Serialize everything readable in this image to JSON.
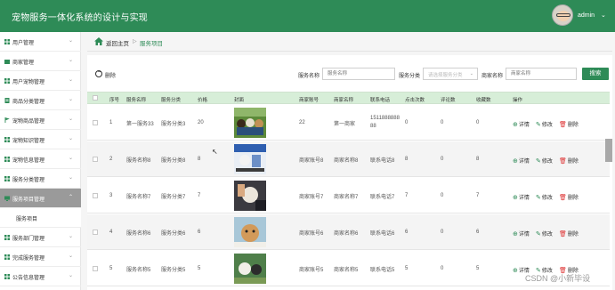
{
  "app": {
    "title": "宠物服务一体化系统的设计与实现",
    "user": "admin",
    "colors": {
      "header": "#2e8b57",
      "table_header": "#d7eed8",
      "accent": "#2e8b57",
      "delete": "#dd3333"
    }
  },
  "sidebar": {
    "items": [
      {
        "label": "用户管理",
        "icon": "grid-icon"
      },
      {
        "label": "商家管理",
        "icon": "folder-icon"
      },
      {
        "label": "用户宠物管理",
        "icon": "grid-icon"
      },
      {
        "label": "商品分类管理",
        "icon": "doc-icon"
      },
      {
        "label": "宠物商品管理",
        "icon": "flag-icon"
      },
      {
        "label": "宠物知识管理",
        "icon": "grid-icon"
      },
      {
        "label": "宠物信息管理",
        "icon": "grid-icon"
      },
      {
        "label": "服务分类管理",
        "icon": "grid-icon"
      },
      {
        "label": "服务项目管理",
        "icon": "monitor-icon",
        "active": true
      },
      {
        "label": "服务项目",
        "sub": true
      },
      {
        "label": "服务部门管理",
        "icon": "grid-icon"
      },
      {
        "label": "完成服务管理",
        "icon": "grid-icon"
      },
      {
        "label": "公告信息管理",
        "icon": "grid-icon"
      }
    ]
  },
  "breadcrumb": {
    "home": "返回主页",
    "separator": "▷",
    "current": "服务项目"
  },
  "toolbar": {
    "delete_label": "删除",
    "search_label": "搜索"
  },
  "filters": {
    "name": {
      "label": "服务名称",
      "placeholder": "服务名称"
    },
    "category": {
      "label": "服务分类",
      "placeholder": "请选择服务分类"
    },
    "merchant": {
      "label": "商家名称",
      "placeholder": "商家名称"
    }
  },
  "table": {
    "headers": [
      "序号",
      "服务名称",
      "服务分类",
      "价格",
      "封面",
      "商家账号",
      "商家名称",
      "联系电话",
      "点击次数",
      "评论数",
      "收藏数",
      "操作"
    ],
    "actions": {
      "detail": "详情",
      "edit": "修改",
      "delete": "删除"
    },
    "rows": [
      {
        "no": "1",
        "name": "第一服务33",
        "category": "服务分类3",
        "price": "20",
        "cover": "dogs-group-photo",
        "account": "22",
        "merchant": "第一商家",
        "phone": "151188888888",
        "clicks": "0",
        "comments": "0",
        "favorites": "0"
      },
      {
        "no": "2",
        "name": "服务名称8",
        "category": "服务分类8",
        "price": "8",
        "cover": "pet-grooming-photo",
        "account": "商家账号8",
        "merchant": "商家名称8",
        "phone": "联系电话8",
        "clicks": "8",
        "comments": "0",
        "favorites": "8"
      },
      {
        "no": "3",
        "name": "服务名称7",
        "category": "服务分类7",
        "price": "7",
        "cover": "dog-bath-photo",
        "account": "商家账号7",
        "merchant": "商家名称7",
        "phone": "联系电话7",
        "clicks": "7",
        "comments": "0",
        "favorites": "7"
      },
      {
        "no": "4",
        "name": "服务名称6",
        "category": "服务分类6",
        "price": "6",
        "cover": "puppy-care-photo",
        "account": "商家账号6",
        "merchant": "商家名称6",
        "phone": "联系电话6",
        "clicks": "6",
        "comments": "0",
        "favorites": "6"
      },
      {
        "no": "5",
        "name": "服务名称5",
        "category": "服务分类5",
        "price": "5",
        "cover": "dog-trim-photo",
        "account": "商家账号5",
        "merchant": "商家名称5",
        "phone": "联系电话5",
        "clicks": "5",
        "comments": "0",
        "favorites": "5"
      }
    ]
  },
  "watermark": "CSDN @小新毕设"
}
